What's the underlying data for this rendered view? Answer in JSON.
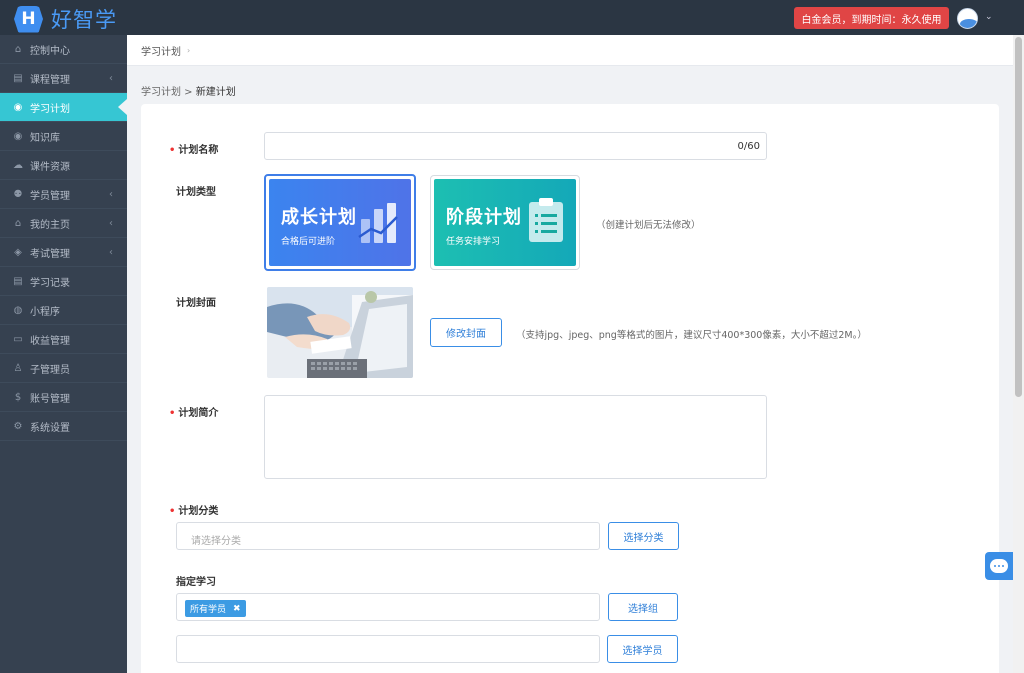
{
  "app": {
    "logo_letter": "H",
    "name": "好智学"
  },
  "header": {
    "member_badge": "白金会员，到期时间：永久使用",
    "caret": "⌄"
  },
  "sidebar": {
    "items": [
      {
        "icon": "home-icon",
        "glyph": "⌂",
        "label": "控制中心",
        "chevron": "",
        "active": false
      },
      {
        "icon": "book-icon",
        "glyph": "▤",
        "label": "课程管理",
        "chevron": "‹",
        "active": false
      },
      {
        "icon": "eye-icon",
        "glyph": "◉",
        "label": "学习计划",
        "chevron": "",
        "active": true
      },
      {
        "icon": "eye-icon",
        "glyph": "◉",
        "label": "知识库",
        "chevron": "",
        "active": false
      },
      {
        "icon": "cloud-upload-icon",
        "glyph": "☁",
        "label": "课件资源",
        "chevron": "",
        "active": false
      },
      {
        "icon": "users-icon",
        "glyph": "⚉",
        "label": "学员管理",
        "chevron": "‹",
        "active": false
      },
      {
        "icon": "graduation-cap-icon",
        "glyph": "⌂",
        "label": "我的主页",
        "chevron": "‹",
        "active": false
      },
      {
        "icon": "tag-icon",
        "glyph": "◈",
        "label": "考试管理",
        "chevron": "‹",
        "active": false
      },
      {
        "icon": "book-icon",
        "glyph": "▤",
        "label": "学习记录",
        "chevron": "",
        "active": false
      },
      {
        "icon": "wechat-icon",
        "glyph": "◍",
        "label": "小程序",
        "chevron": "",
        "active": false
      },
      {
        "icon": "credit-card-icon",
        "glyph": "▭",
        "label": "收益管理",
        "chevron": "",
        "active": false
      },
      {
        "icon": "user-secret-icon",
        "glyph": "♙",
        "label": "子管理员",
        "chevron": "",
        "active": false
      },
      {
        "icon": "dollar-icon",
        "glyph": "$",
        "label": "账号管理",
        "chevron": "",
        "active": false
      },
      {
        "icon": "gear-icon",
        "glyph": "⚙",
        "label": "系统设置",
        "chevron": "",
        "active": false
      }
    ]
  },
  "top_breadcrumb": {
    "label": "学习计划",
    "sep": "›"
  },
  "page_breadcrumb": {
    "parent": "学习计划",
    "sep": " > ",
    "current": "新建计划"
  },
  "form": {
    "plan_name": {
      "label": "计划名称",
      "value": "",
      "counter": "0/60",
      "required": true
    },
    "plan_type": {
      "label": "计划类型",
      "options": [
        {
          "title": "成长计划",
          "subtitle": "合格后可进阶",
          "selected": true
        },
        {
          "title": "阶段计划",
          "subtitle": "任务安排学习",
          "selected": false
        }
      ],
      "note": "（创建计划后无法修改）"
    },
    "cover": {
      "label": "计划封面",
      "button": "修改封面",
      "note": "（支持jpg、jpeg、png等格式的图片，建议尺寸400*300像素，大小不超过2M。）"
    },
    "intro": {
      "label": "计划简介",
      "value": "",
      "required": true
    },
    "category": {
      "label": "计划分类",
      "placeholder": "请选择分类",
      "button": "选择分类",
      "required": true
    },
    "assign": {
      "label": "指定学习",
      "group_tag": "所有学员",
      "group_tag_remove": "✖",
      "group_button": "选择组",
      "student_button": "选择学员"
    }
  },
  "colors": {
    "accent": "#36c6d3",
    "sidebar_bg": "#364150",
    "topbar_bg": "#2b3643",
    "badge_red": "#e04545",
    "primary_blue": "#3a8ee6"
  }
}
